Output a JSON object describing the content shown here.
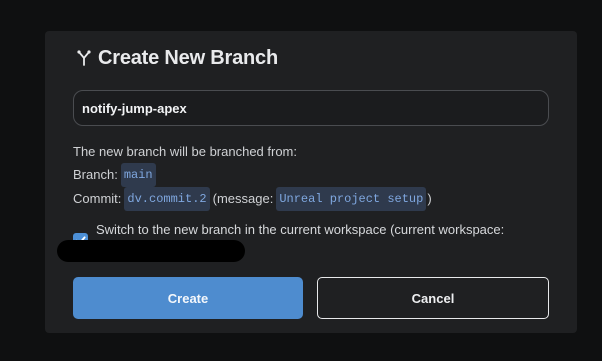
{
  "dialog": {
    "title": "Create New Branch",
    "title_icon": "branch-fork-icon",
    "branch_name_value": "notify-jump-apex",
    "info": {
      "intro": "The new branch will be branched from:",
      "branch_label": "Branch:",
      "branch_value": "main",
      "commit_label": "Commit:",
      "commit_value": "dv.commit.2",
      "message_prefix": "(message:",
      "message_value": "Unreal project setup",
      "message_suffix": ")"
    },
    "switch_checkbox": {
      "checked": true,
      "label": "Switch to the new branch in the current workspace (current workspace:"
    },
    "buttons": {
      "create": "Create",
      "cancel": "Cancel"
    }
  },
  "colors": {
    "accent": "#4e8ccf",
    "code_bg": "#2f3a4d",
    "code_text": "#7fa7df",
    "dialog_bg": "#1f2022"
  }
}
